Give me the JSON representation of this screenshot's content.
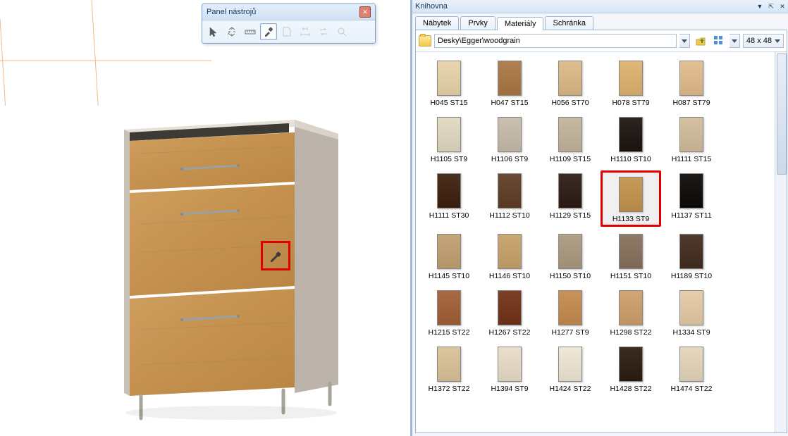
{
  "toolbar": {
    "title": "Panel nástrojů",
    "tools": [
      {
        "name": "cursor",
        "active": false
      },
      {
        "name": "measure",
        "active": false
      },
      {
        "name": "ruler",
        "active": false
      },
      {
        "name": "eyedropper",
        "active": true
      },
      {
        "name": "page",
        "active": false,
        "disabled": true
      },
      {
        "name": "dims",
        "active": false,
        "disabled": true
      },
      {
        "name": "swap",
        "active": false,
        "disabled": true
      },
      {
        "name": "zoom",
        "active": false,
        "disabled": true
      }
    ]
  },
  "library": {
    "title": "Knihovna",
    "tabs": [
      {
        "id": "nabytek",
        "label": "Nábytek"
      },
      {
        "id": "prvky",
        "label": "Prvky"
      },
      {
        "id": "materialy",
        "label": "Materiály"
      },
      {
        "id": "schranka",
        "label": "Schránka"
      }
    ],
    "active_tab": "materialy",
    "path": "Desky\\Egger\\woodgrain",
    "thumb_size": "48 x  48",
    "selected": "H1133 ST9",
    "swatches": [
      {
        "label": "H045 ST15",
        "color": "#e9d6b0"
      },
      {
        "label": "H047 ST15",
        "color": "#b08052"
      },
      {
        "label": "H056 ST70",
        "color": "#debd8e"
      },
      {
        "label": "H078 ST79",
        "color": "#e0b779"
      },
      {
        "label": "H087 ST79",
        "color": "#e2c093"
      },
      {
        "label": "H1105 ST9",
        "color": "#e4dbc5"
      },
      {
        "label": "H1106 ST9",
        "color": "#cbc0b0"
      },
      {
        "label": "H1109 ST15",
        "color": "#c6b9a3"
      },
      {
        "label": "H1110 ST10",
        "color": "#2c2420"
      },
      {
        "label": "H1111 ST15",
        "color": "#d5c0a2"
      },
      {
        "label": "H1111 ST30",
        "color": "#4a2e1e"
      },
      {
        "label": "H1112 ST10",
        "color": "#6a4a34"
      },
      {
        "label": "H1129 ST15",
        "color": "#3a2b24"
      },
      {
        "label": "H1133 ST9",
        "color": "#c69a58"
      },
      {
        "label": "H1137 ST11",
        "color": "#1e1a18"
      },
      {
        "label": "H1145 ST10",
        "color": "#c5a57a"
      },
      {
        "label": "H1146 ST10",
        "color": "#caa876"
      },
      {
        "label": "H1150 ST10",
        "color": "#b0a088"
      },
      {
        "label": "H1151 ST10",
        "color": "#8e7a66"
      },
      {
        "label": "H1189 ST10",
        "color": "#4e3a2e"
      },
      {
        "label": "H1215 ST22",
        "color": "#a86a44"
      },
      {
        "label": "H1267 ST22",
        "color": "#7a4028"
      },
      {
        "label": "H1277 ST9",
        "color": "#c8935a"
      },
      {
        "label": "H1298 ST22",
        "color": "#d0a674"
      },
      {
        "label": "H1334 ST9",
        "color": "#e6ceac"
      },
      {
        "label": "H1372 ST22",
        "color": "#dcc6a0"
      },
      {
        "label": "H1394 ST9",
        "color": "#eadfca"
      },
      {
        "label": "H1424 ST22",
        "color": "#f0e8d6"
      },
      {
        "label": "H1428 ST22",
        "color": "#3a2c20"
      },
      {
        "label": "H1474 ST22",
        "color": "#e6d8be"
      }
    ]
  }
}
